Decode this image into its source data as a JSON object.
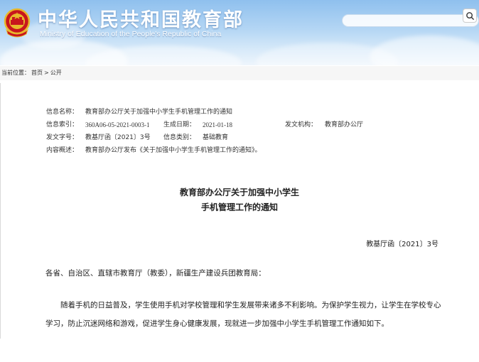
{
  "header": {
    "title": "中华人民共和国教育部",
    "subtitle": "Ministry of Education of the People's Republic of China",
    "search_placeholder": ""
  },
  "breadcrumb": {
    "label": "当前位置：",
    "items": [
      "首页",
      "公开"
    ],
    "separator": ">"
  },
  "info": {
    "name_label": "信息名称：",
    "name_value": "教育部办公厅关于加强中小学生手机管理工作的通知",
    "index_label": "信息索引：",
    "index_value": "360A06-05-2021-0003-1",
    "date_label": "生成日期：",
    "date_value": "2021-01-18",
    "org_label": "发文机构：",
    "org_value": "教育部办公厅",
    "docno_label": "发文字号：",
    "docno_value": "教基厅函〔2021〕3号",
    "category_label": "信息类别：",
    "category_value": "基础教育",
    "summary_label": "内容概述：",
    "summary_value": "教育部办公厅发布《关于加强中小学生手机管理工作的通知》。"
  },
  "document": {
    "title_line1": "教育部办公厅关于加强中小学生",
    "title_line2": "手机管理工作的通知",
    "doc_number": "教基厅函〔2021〕3号",
    "salutation": "各省、自治区、直辖市教育厅（教委），新疆生产建设兵团教育局：",
    "paragraph1": "随着手机的日益普及，学生使用手机对学校管理和学生发展带来诸多不利影响。为保护学生视力，让学生在学校专心学习，防止沉迷网络和游戏，促进学生身心健康发展，现就进一步加强中小学生手机管理工作通知如下。"
  }
}
